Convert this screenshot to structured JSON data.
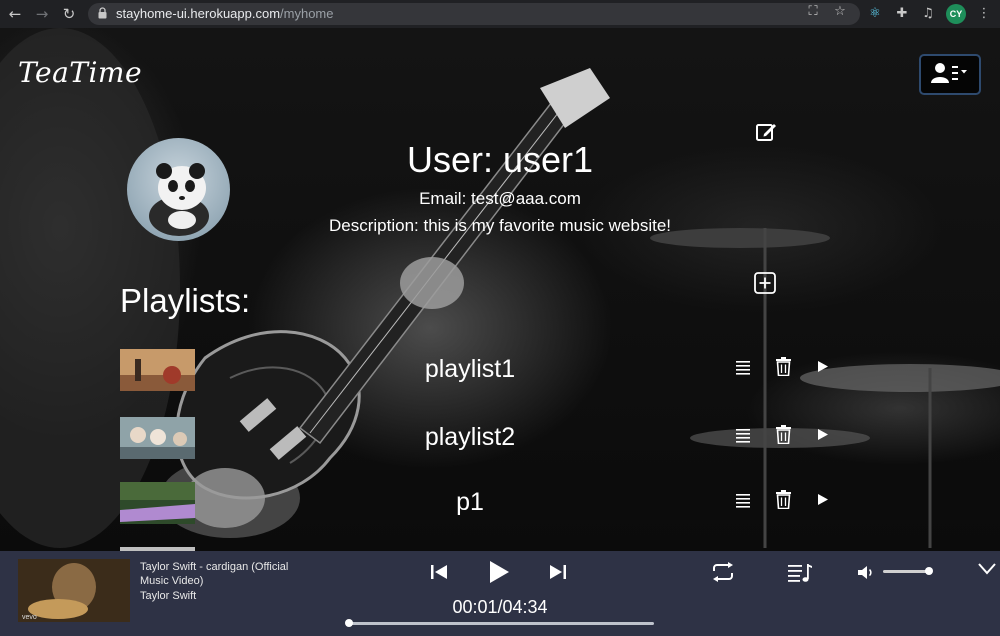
{
  "browser": {
    "back_icon": "arrow-left-icon",
    "forward_icon": "arrow-right-icon",
    "reload_icon": "reload-icon",
    "url_host": "stayhome-ui.herokuapp.com",
    "url_path": "/myhome",
    "profile_initials": "CY"
  },
  "header": {
    "logo": "TeaTime",
    "user_menu_icon": "user-list-icon"
  },
  "profile": {
    "title": "User: user1",
    "email": "Email: test@aaa.com",
    "description": "Description: this is my favorite music website!",
    "avatar": "panda-avatar"
  },
  "playlists": {
    "heading": "Playlists:",
    "items": [
      {
        "name": "playlist1"
      },
      {
        "name": "playlist2"
      },
      {
        "name": "p1"
      }
    ]
  },
  "player": {
    "title": "Taylor Swift - cardigan (Official Music Video)",
    "artist": "Taylor Swift",
    "time": "00:01/04:34",
    "progress_fraction": 0.004,
    "volume_fraction": 0.95
  }
}
